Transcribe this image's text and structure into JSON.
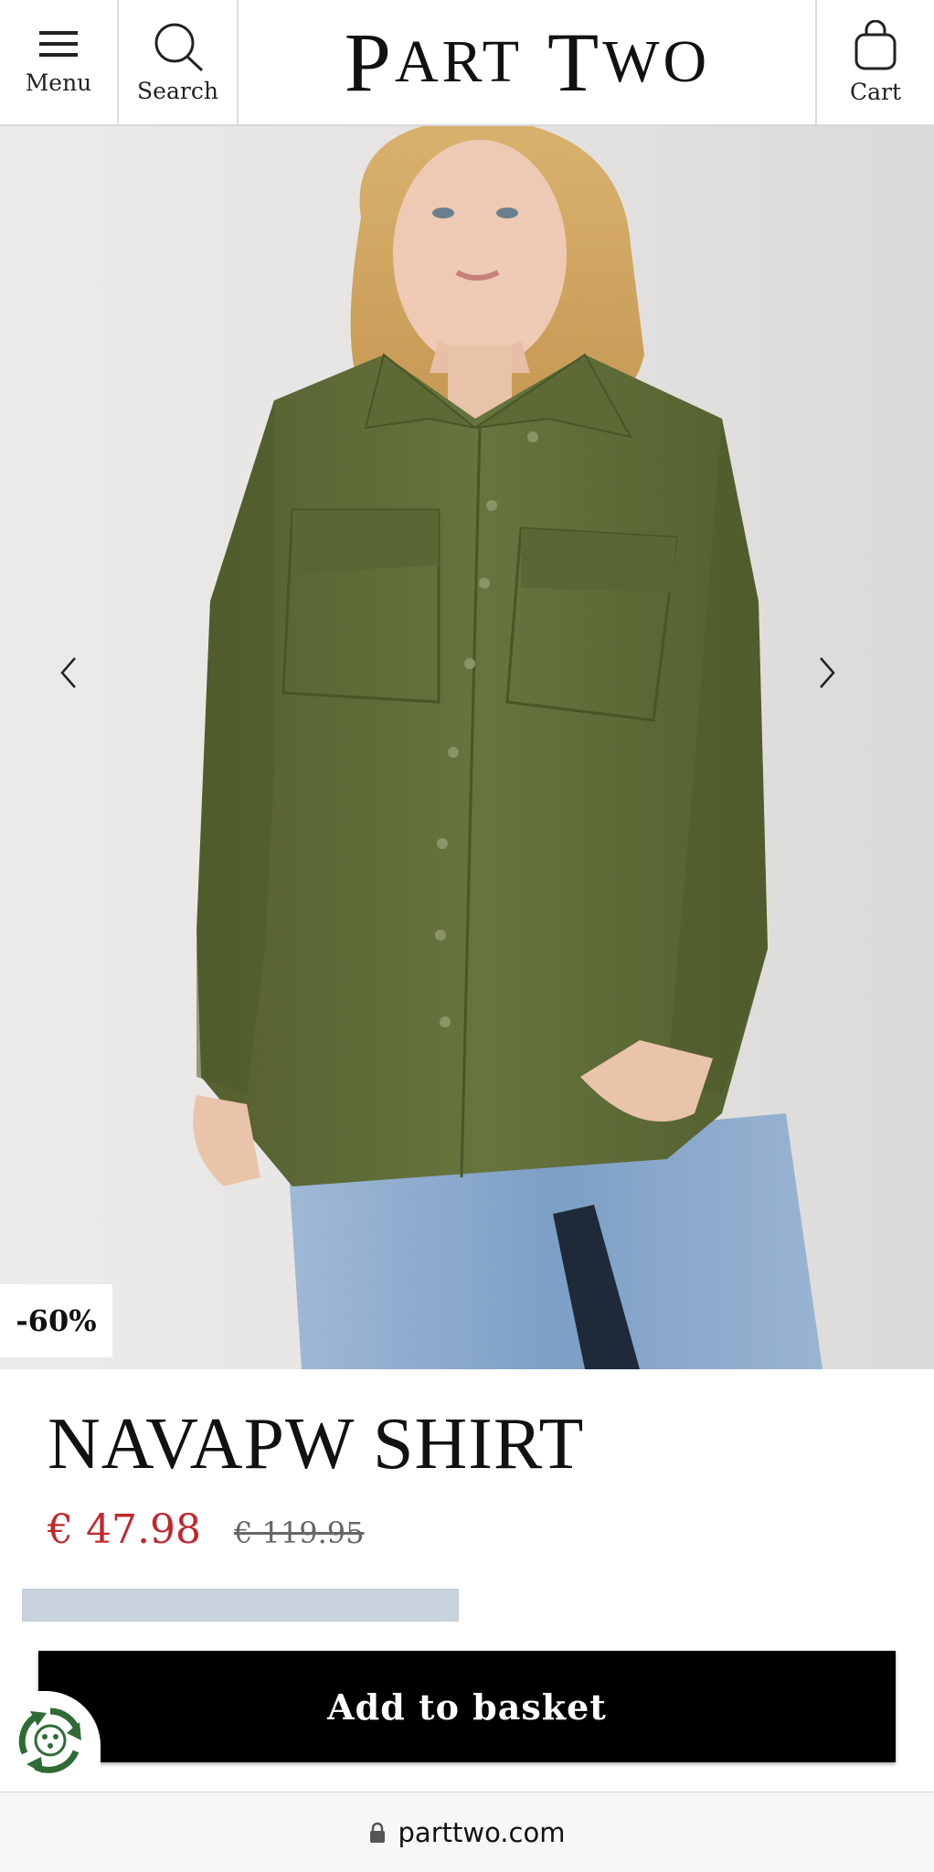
{
  "header": {
    "menu_label": "Menu",
    "search_label": "Search",
    "cart_label": "Cart",
    "logo_text_1": "P",
    "logo_text_2": "ART",
    "logo_text_3": "T",
    "logo_text_4": "WO"
  },
  "gallery": {
    "discount_badge": "-60%"
  },
  "product": {
    "title": "NAVAPW SHIRT",
    "price_current": "€ 47.98",
    "price_original": "€ 119.95",
    "add_to_basket": "Add to basket"
  },
  "browser": {
    "url": "parttwo.com"
  },
  "colors": {
    "price_red": "#c1272d",
    "button_black": "#000000",
    "shirt_olive": "#5e6b3a",
    "denim_blue": "#8aa9cc",
    "size_strip": "#c8d3de",
    "eco_green": "#2f6b35"
  }
}
